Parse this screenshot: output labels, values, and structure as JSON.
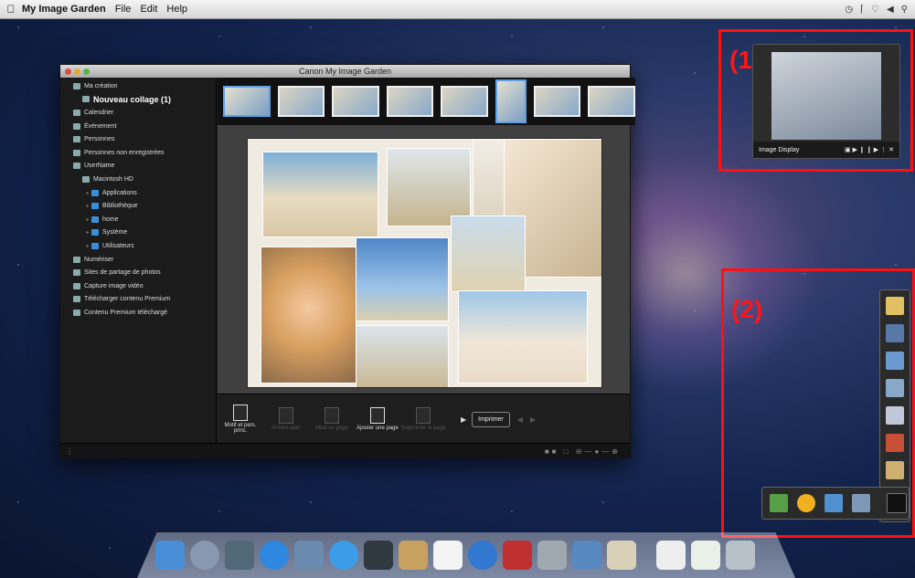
{
  "menubar": {
    "app_name": "My Image Garden",
    "menus": [
      "File",
      "Edit",
      "Help"
    ]
  },
  "window": {
    "title": "Canon My Image Garden"
  },
  "sidebar": {
    "items": [
      {
        "label": "Ma création",
        "indent": 0,
        "bold": false
      },
      {
        "label": "Nouveau collage (1)",
        "indent": 1,
        "bold": true
      },
      {
        "label": "Calendrier",
        "indent": 0,
        "bold": false
      },
      {
        "label": "Événement",
        "indent": 0,
        "bold": false
      },
      {
        "label": "Personnes",
        "indent": 0,
        "bold": false
      },
      {
        "label": "Personnes non enregistrées",
        "indent": 0,
        "bold": false
      },
      {
        "label": "UserName",
        "indent": 0,
        "bold": false
      },
      {
        "label": "Macintosh HD",
        "indent": 1,
        "bold": false
      },
      {
        "label": "Applications",
        "indent": 2,
        "bold": false
      },
      {
        "label": "Bibliothèque",
        "indent": 2,
        "bold": false
      },
      {
        "label": "home",
        "indent": 2,
        "bold": false
      },
      {
        "label": "Système",
        "indent": 2,
        "bold": false
      },
      {
        "label": "Utilisateurs",
        "indent": 2,
        "bold": false
      },
      {
        "label": "Numériser",
        "indent": 0,
        "bold": false
      },
      {
        "label": "Sites de partage de photos",
        "indent": 0,
        "bold": false
      },
      {
        "label": "Capture image vidéo",
        "indent": 0,
        "bold": false
      },
      {
        "label": "Télécharger contenu Premium",
        "indent": 0,
        "bold": false
      },
      {
        "label": "Contenu Premium téléchargé",
        "indent": 0,
        "bold": false
      }
    ]
  },
  "toolbar": {
    "buttons": [
      {
        "label": "Motif et pers. princ.",
        "enabled": true
      },
      {
        "label": "Arrière-plan",
        "enabled": false
      },
      {
        "label": "Mise en page",
        "enabled": false
      },
      {
        "label": "Ajouter une page",
        "enabled": true
      },
      {
        "label": "Supprimer la page",
        "enabled": false
      }
    ],
    "print_label": "Imprimer"
  },
  "image_display": {
    "label": "Image Display"
  },
  "annotations": {
    "label1": "(1)",
    "label2": "(2)",
    "box_color": "#ff1010"
  }
}
